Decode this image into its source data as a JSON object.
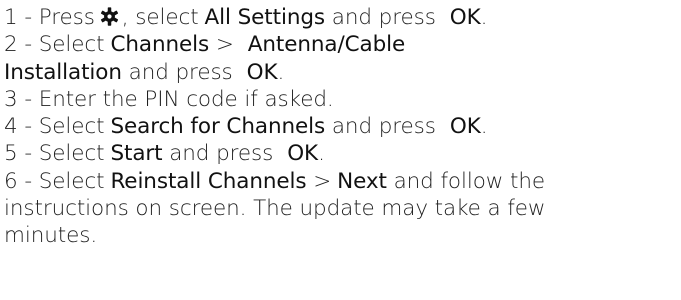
{
  "steps": [
    {
      "prefix": "1 - Press",
      "icon": "gear-icon",
      "after_icon": ", select",
      "bold1": "All Settings",
      "mid": "and press",
      "bold2": "OK",
      "end": "."
    },
    {
      "prefix": "2 - Select",
      "bold1": "Channels",
      "sep": ">",
      "bold2a": "Antenna/Cable",
      "bold2b": "Installation",
      "mid": "and press",
      "bold3": "OK",
      "end": "."
    },
    {
      "text": "3 - Enter the PIN code if asked."
    },
    {
      "prefix": "4 - Select",
      "bold1": "Search for Channels",
      "mid": "and press",
      "bold2": "OK",
      "end": "."
    },
    {
      "prefix": "5 - Select",
      "bold1": "Start",
      "mid": "and press",
      "bold2": "OK",
      "end": "."
    },
    {
      "prefix": "6 - Select",
      "bold1": "Reinstall Channels",
      "sep": ">",
      "bold2": "Next",
      "line1_end": "and follow the",
      "line2": "instructions on screen. The update may take a few",
      "line3": "minutes."
    }
  ]
}
